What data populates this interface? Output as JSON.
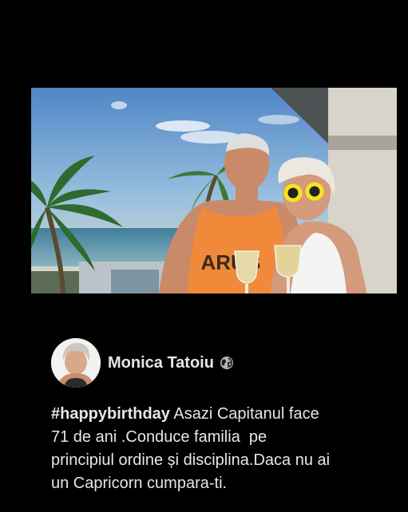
{
  "post": {
    "author_name": "Monica Tatoiu",
    "audience_icon": "globe-icon",
    "hashtag": "#happybirthday",
    "text": " Asazi Capitanul face\n71 de ani .Conduce familia  pe\nprincipiul ordine și disciplina.Daca nu ai\nun Capricorn cumpara-ti.",
    "photo_shirt_text": "ARUB"
  },
  "colors": {
    "background": "#000000",
    "text": "#e4e6eb"
  }
}
